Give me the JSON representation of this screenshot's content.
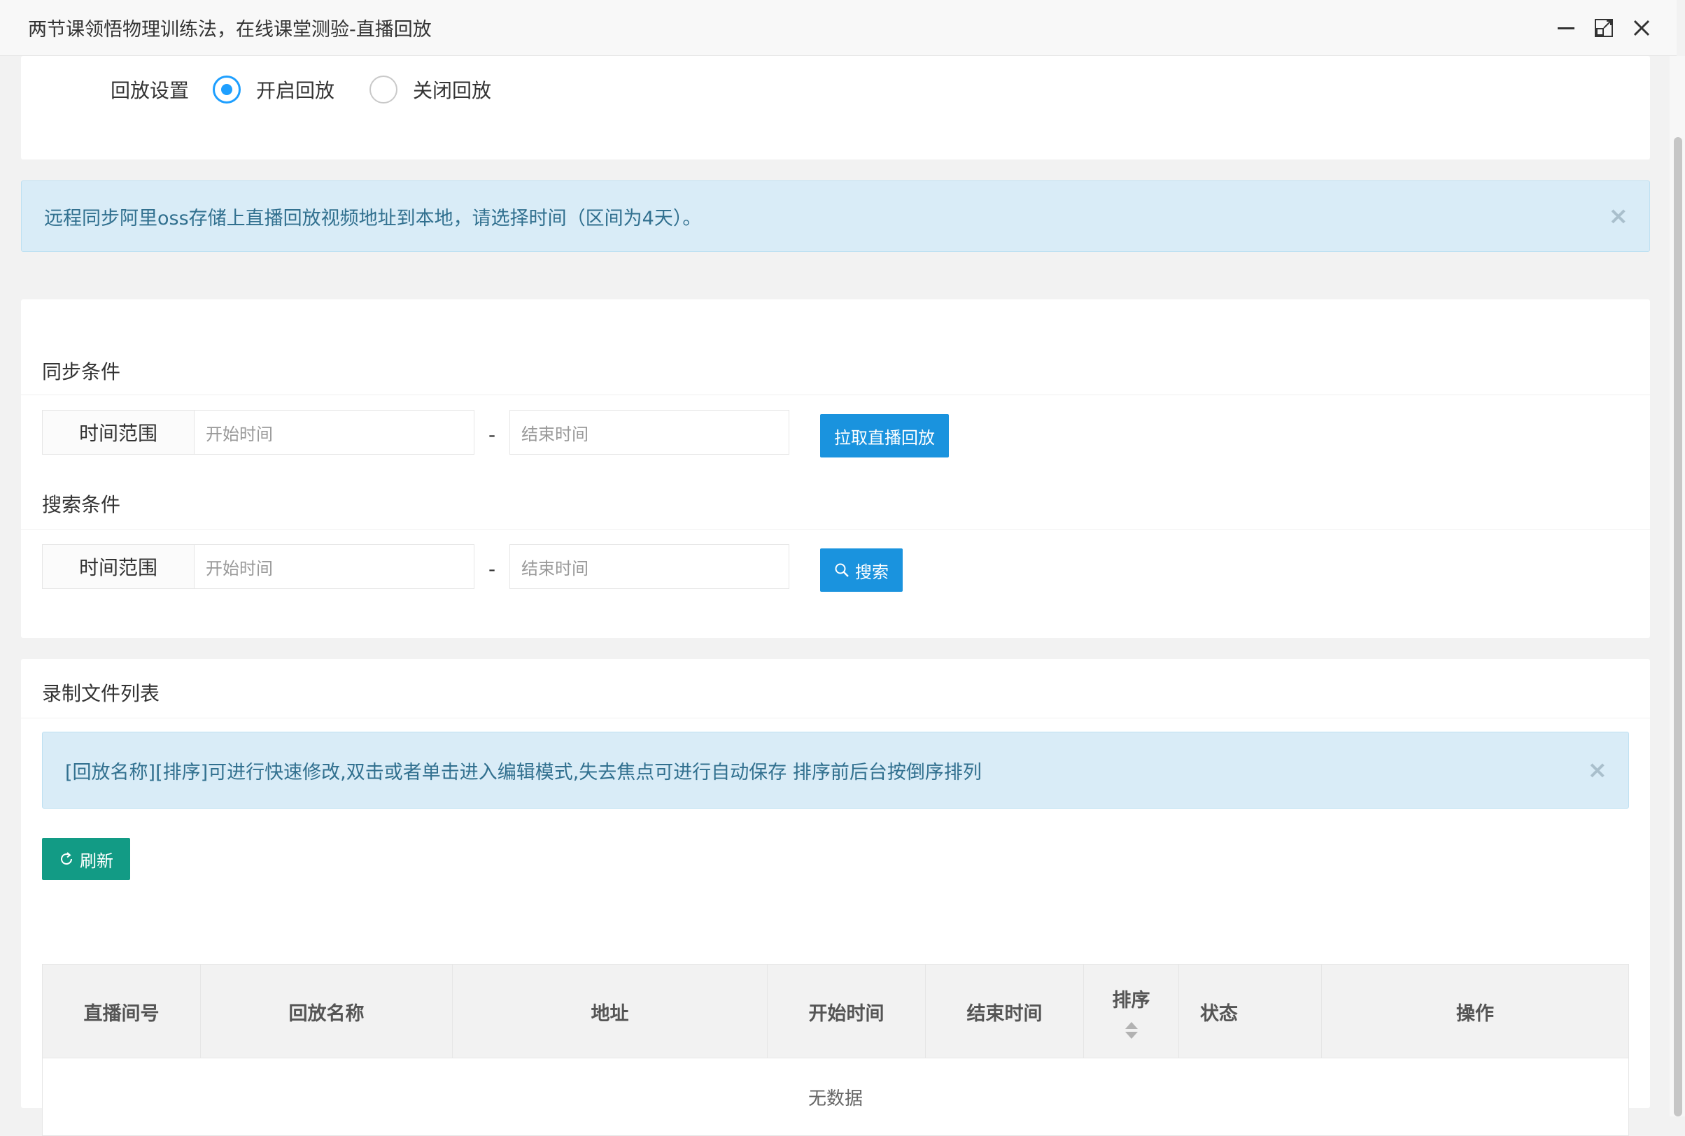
{
  "window": {
    "title": "两节课领悟物理训练法，在线课堂测验-直播回放"
  },
  "replay_setting": {
    "label": "回放设置",
    "options": [
      {
        "label": "开启回放",
        "checked": true
      },
      {
        "label": "关闭回放",
        "checked": false
      }
    ]
  },
  "sync_alert": {
    "text": "远程同步阿里oss存储上直播回放视频地址到本地，请选择时间（区间为4天）。",
    "close": "×"
  },
  "sync": {
    "title": "同步条件",
    "range_label": "时间范围",
    "start_placeholder": "开始时间",
    "dash": "-",
    "end_placeholder": "结束时间",
    "button": "拉取直播回放"
  },
  "search": {
    "title": "搜索条件",
    "range_label": "时间范围",
    "start_placeholder": "开始时间",
    "dash": "-",
    "end_placeholder": "结束时间",
    "button": "搜索"
  },
  "record_list": {
    "title": "录制文件列表",
    "alert": "[回放名称][排序]可进行快速修改,双击或者单击进入编辑模式,失去焦点可进行自动保存 排序前后台按倒序排列",
    "alert_close": "×",
    "refresh": "刷新",
    "columns": [
      "直播间号",
      "回放名称",
      "地址",
      "开始时间",
      "结束时间",
      "排序",
      "状态",
      "操作"
    ],
    "empty": "无数据"
  },
  "colors": {
    "primary_blue": "#1a93de",
    "refresh_green": "#129b85",
    "alert_bg": "#d9ecf7",
    "radio_active": "#1E9FFF"
  }
}
